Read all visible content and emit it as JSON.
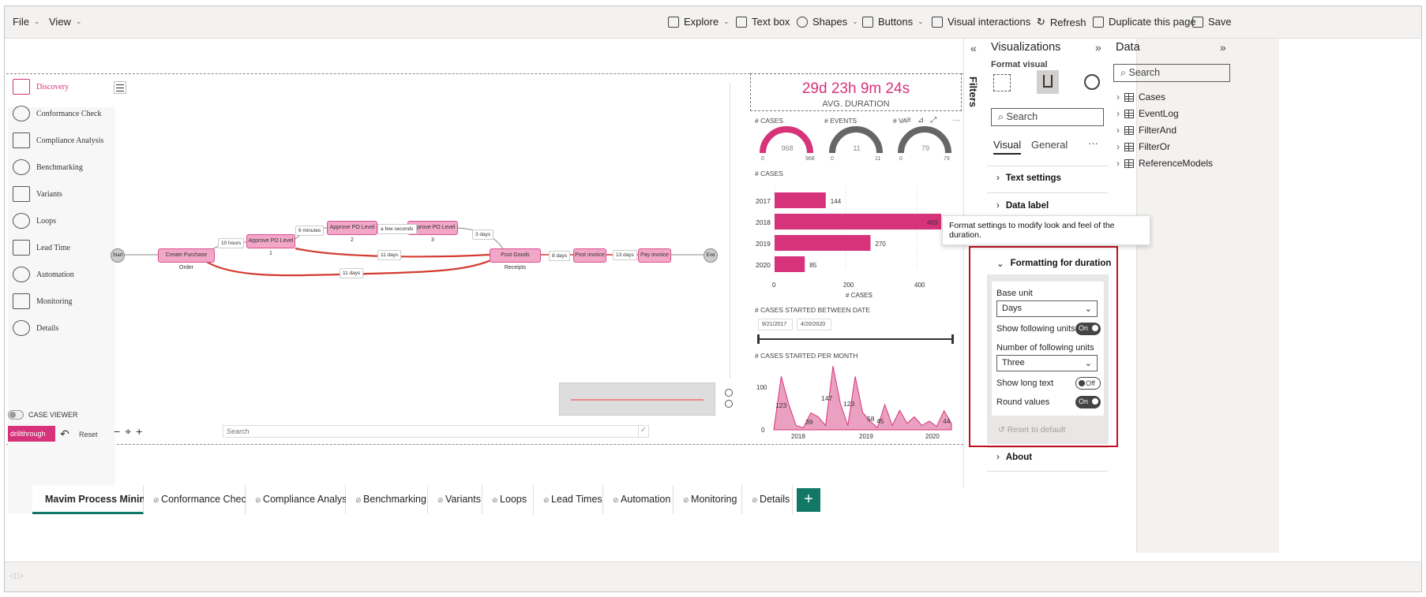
{
  "toolbar": {
    "file": "File",
    "view": "View",
    "explore": "Explore",
    "textbox": "Text box",
    "shapes": "Shapes",
    "buttons": "Buttons",
    "visual_interactions": "Visual interactions",
    "refresh": "Refresh",
    "duplicate": "Duplicate this page",
    "save": "Save"
  },
  "nav": {
    "items": [
      "Discovery",
      "Conformance Check",
      "Compliance Analysis",
      "Benchmarking",
      "Variants",
      "Loops",
      "Lead Time",
      "Automation",
      "Monitoring",
      "Details"
    ],
    "case_viewer": "CASE VIEWER",
    "drillthrough": "drillthrough",
    "reset": "Reset"
  },
  "process_map": {
    "nodes": [
      "Start",
      "Create Purchase Order",
      "Approve PO Level 1",
      "Approve PO Level 2",
      "Approve PO Level 3",
      "Post Goods Receipts",
      "Post invoice",
      "Pay invoice",
      "End"
    ],
    "edge_labels": [
      "10 hours",
      "6 minutes",
      "a few seconds",
      "3 days",
      "11 days",
      "11 days",
      "8 days",
      "13 days"
    ],
    "search_placeholder": "Search"
  },
  "kpi": {
    "duration": "29d 23h 9m 24s",
    "duration_label": "AVG. DURATION"
  },
  "gauges": [
    {
      "title": "# CASES",
      "value": "968",
      "min": "0",
      "max": "968",
      "fraction": 1.0
    },
    {
      "title": "# EVENTS",
      "value": "11",
      "min": "0",
      "max": "11",
      "fraction": 1.0
    },
    {
      "title": "# VA",
      "value": "79",
      "min": "0",
      "max": "79",
      "fraction": 1.0
    }
  ],
  "bar_chart": {
    "title": "# CASES",
    "xlabel": "# CASES",
    "xticks": [
      "0",
      "200",
      "400"
    ],
    "rows": [
      {
        "label": "2017",
        "value": 144
      },
      {
        "label": "2018",
        "value": 469
      },
      {
        "label": "2019",
        "value": 270
      },
      {
        "label": "2020",
        "value": 85
      }
    ]
  },
  "date_slicer": {
    "title": "# CASES STARTED BETWEEN DATE",
    "start": "9/21/2017",
    "end": "4/20/2020"
  },
  "area_chart": {
    "title": "# CASES STARTED PER MONTH",
    "yticks": [
      "100",
      "0"
    ],
    "xticks": [
      "2018",
      "2019",
      "2020"
    ],
    "labels": [
      "123",
      "39",
      "147",
      "123",
      "58",
      "45",
      "44"
    ]
  },
  "tooltip": "Format settings to modify look and feel of the duration.",
  "filters_label": "Filters",
  "viz_pane": {
    "title": "Visualizations",
    "format_visual": "Format visual",
    "search": "Search",
    "tab_visual": "Visual",
    "tab_general": "General",
    "more": "···",
    "sections": {
      "text_settings": "Text settings",
      "data_label": "Data label",
      "formatting_duration": "Formatting for duration",
      "about": "About"
    },
    "base_unit_label": "Base unit",
    "base_unit_value": "Days",
    "show_following_units": "Show following units",
    "show_following_units_state": "On",
    "number_following_units": "Number of following units",
    "number_following_units_value": "Three",
    "show_long_text": "Show long text",
    "show_long_text_state": "Off",
    "round_values": "Round values",
    "round_values_state": "On",
    "reset_default": "Reset to default"
  },
  "data_pane": {
    "title": "Data",
    "search": "Search",
    "tables": [
      "Cases",
      "EventLog",
      "FilterAnd",
      "FilterOr",
      "ReferenceModels"
    ]
  },
  "page_tabs": [
    "Mavim Process Mining",
    "Conformance Check",
    "Compliance Analysis",
    "Benchmarking",
    "Variants",
    "Loops",
    "Lead Times",
    "Automation",
    "Monitoring",
    "Details"
  ],
  "colors": {
    "accent": "#d6337a",
    "selected_border": "#c50f1f",
    "toggle_on": "#444444"
  }
}
